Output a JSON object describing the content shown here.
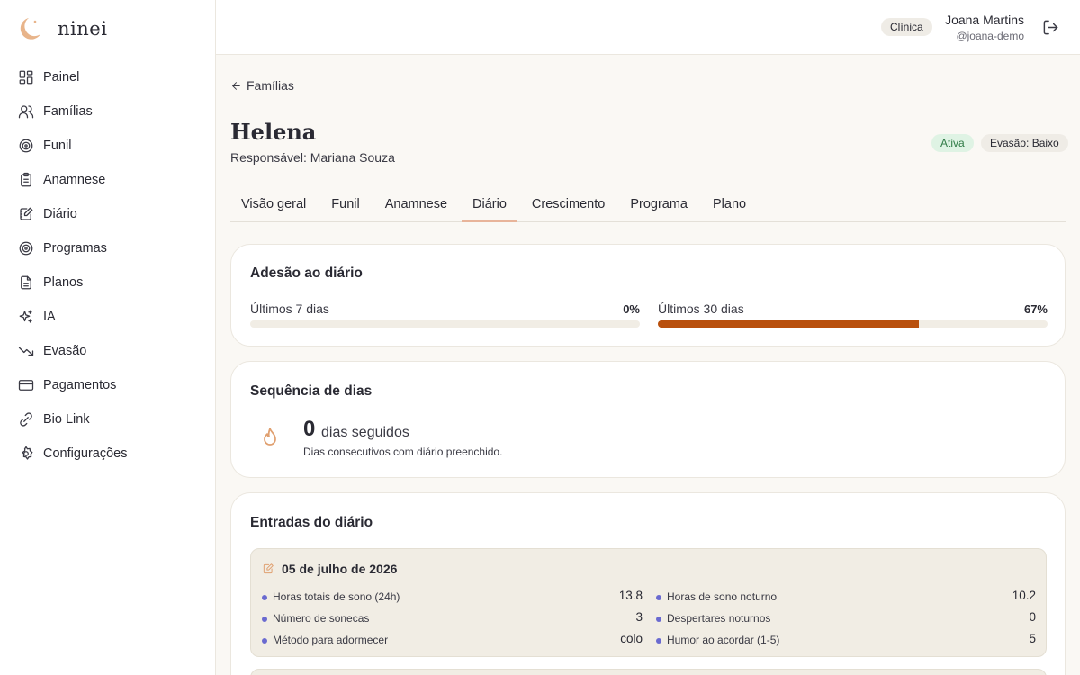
{
  "brand": {
    "name": "ninei",
    "accent": "#e0a070"
  },
  "sidebar": {
    "items": [
      {
        "label": "Painel",
        "icon": "dashboard-icon"
      },
      {
        "label": "Famílias",
        "icon": "users-icon"
      },
      {
        "label": "Funil",
        "icon": "target-icon"
      },
      {
        "label": "Anamnese",
        "icon": "clipboard-icon"
      },
      {
        "label": "Diário",
        "icon": "journal-edit-icon"
      },
      {
        "label": "Programas",
        "icon": "target-icon"
      },
      {
        "label": "Planos",
        "icon": "document-icon"
      },
      {
        "label": "IA",
        "icon": "sparkles-icon"
      },
      {
        "label": "Evasão",
        "icon": "trending-down-icon"
      },
      {
        "label": "Pagamentos",
        "icon": "credit-card-icon"
      },
      {
        "label": "Bio Link",
        "icon": "link-icon"
      },
      {
        "label": "Configurações",
        "icon": "gear-icon"
      }
    ]
  },
  "header": {
    "role": "Clínica",
    "user_name": "Joana Martins",
    "user_handle": "@joana-demo"
  },
  "page": {
    "back_label": "Famílias",
    "title": "Helena",
    "subtitle": "Responsável: Mariana Souza",
    "status_badge": "Ativa",
    "evasion_badge": "Evasão: Baixo",
    "tabs": [
      "Visão geral",
      "Funil",
      "Anamnese",
      "Diário",
      "Crescimento",
      "Programa",
      "Plano"
    ],
    "active_tab": "Diário"
  },
  "adherence": {
    "title": "Adesão ao diário",
    "week_label": "Últimos 7 dias",
    "week_pct": "0%",
    "week_value": 0,
    "month_label": "Últimos 30 dias",
    "month_pct": "67%",
    "month_value": 0.67,
    "bar_color": "#b9500d"
  },
  "streak": {
    "title": "Sequência de dias",
    "count": "0",
    "unit": "dias seguidos",
    "description": "Dias consecutivos com diário preenchido."
  },
  "entries": {
    "title": "Entradas do diário",
    "items": [
      {
        "date": "05 de julho de 2026",
        "left": [
          {
            "label": "Horas totais de sono (24h)",
            "value": "13.8"
          },
          {
            "label": "Número de sonecas",
            "value": "3"
          },
          {
            "label": "Método para adormecer",
            "value": "colo"
          }
        ],
        "right": [
          {
            "label": "Horas de sono noturno",
            "value": "10.2"
          },
          {
            "label": "Despertares noturnos",
            "value": "0"
          },
          {
            "label": "Humor ao acordar (1-5)",
            "value": "5"
          }
        ]
      }
    ]
  }
}
